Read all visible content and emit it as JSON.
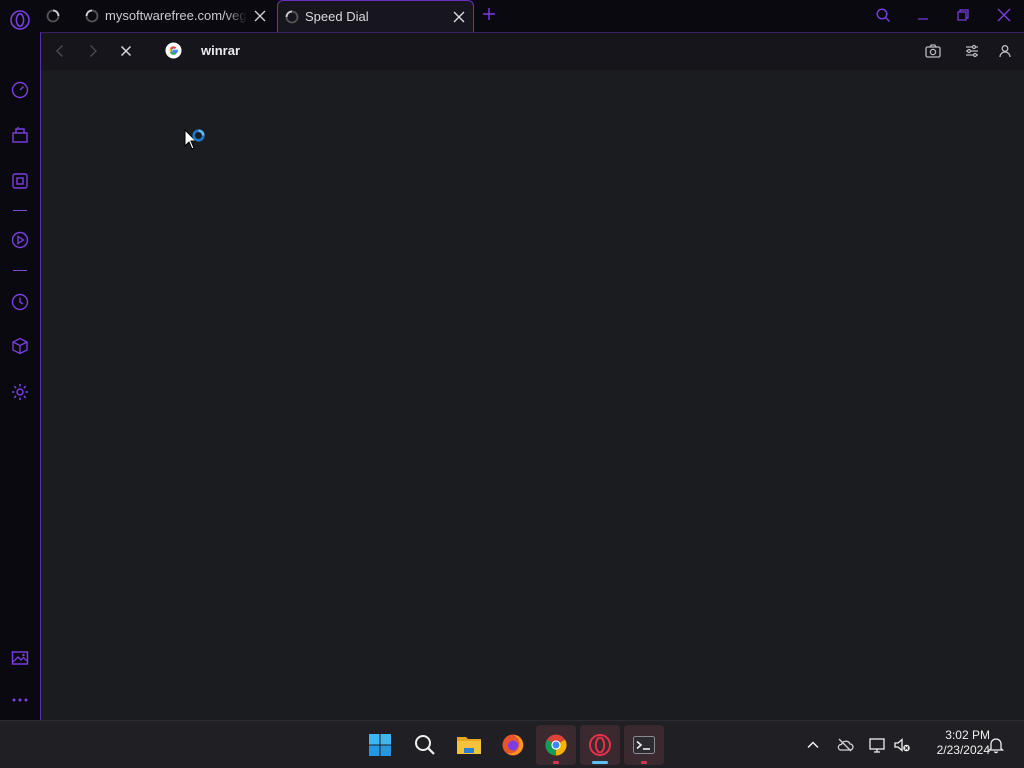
{
  "browser": {
    "tabs": [
      {
        "title": ""
      },
      {
        "title": "mysoftwarefree.com/vegas"
      },
      {
        "title": "Speed Dial"
      }
    ],
    "address": {
      "value": "winrar"
    }
  },
  "taskbar": {
    "apps": [
      "windows-start",
      "search",
      "file-explorer",
      "firefox",
      "chrome",
      "opera",
      "terminal"
    ],
    "clock": {
      "time": "3:02 PM",
      "date": "2/23/2024"
    }
  },
  "colors": {
    "accent": "#7a3fe0",
    "active_tab_border": "#6a2fc0",
    "page_background": "#1b1c20",
    "sidebar_background": "#0a0910"
  }
}
